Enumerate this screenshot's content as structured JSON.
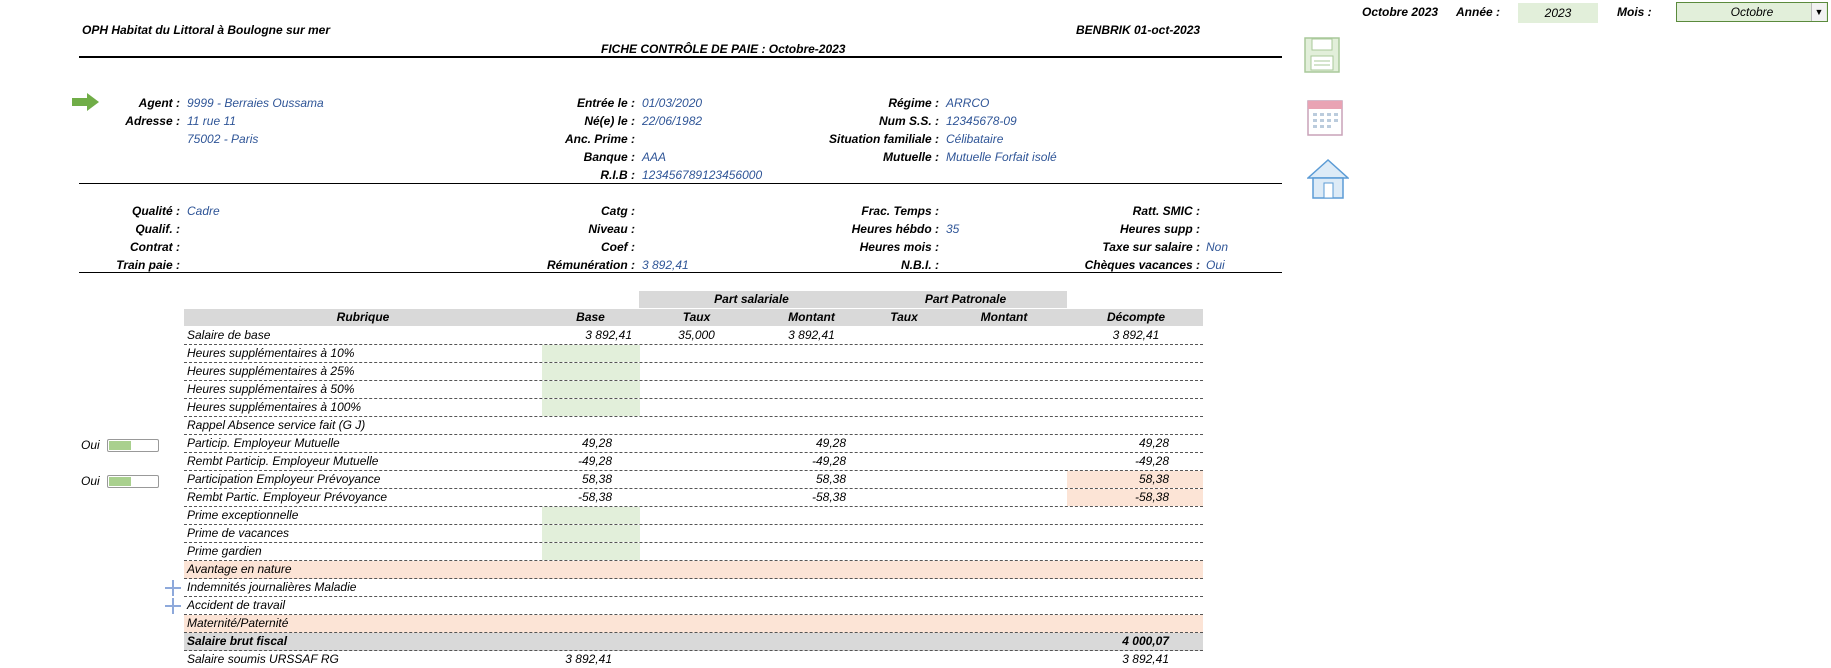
{
  "topbar": {
    "period": "Octobre 2023",
    "year_label": "Année :",
    "year_value": "2023",
    "month_label": "Mois :",
    "month_value": "Octobre"
  },
  "header": {
    "company": "OPH Habitat du Littoral à Boulogne sur mer",
    "stamp": "BENBRIK 01-oct-2023",
    "title": "FICHE CONTRÔLE DE PAIE : Octobre-2023"
  },
  "agent": {
    "agent_label": "Agent :",
    "agent_value": "9999 - Berraies Oussama",
    "adresse_label": "Adresse :",
    "adresse_line1": "11 rue 11",
    "adresse_line2": "75002 - Paris",
    "entree_label": "Entrée le :",
    "entree_value": "01/03/2020",
    "nele_label": "Né(e) le :",
    "nele_value": "22/06/1982",
    "ancprime_label": "Anc. Prime :",
    "banque_label": "Banque :",
    "banque_value": "AAA",
    "rib_label": "R.I.B :",
    "rib_value": "123456789123456000",
    "regime_label": "Régime :",
    "regime_value": "ARRCO",
    "numss_label": "Num S.S. :",
    "numss_value": "12345678-09",
    "sitfam_label": "Situation familiale :",
    "sitfam_value": "Célibataire",
    "mutuelle_label": "Mutuelle :",
    "mutuelle_value": "Mutuelle Forfait isolé"
  },
  "contract": {
    "qualite_label": "Qualité :",
    "qualite_value": "Cadre",
    "qualif_label": "Qualif. :",
    "contrat_label": "Contrat :",
    "trainpaie_label": "Train paie :",
    "catg_label": "Catg :",
    "niveau_label": "Niveau :",
    "coef_label": "Coef :",
    "remun_label": "Rémunération :",
    "remun_value": "3 892,41",
    "fractemps_label": "Frac. Temps :",
    "hhebdo_label": "Heures hébdo :",
    "hhebdo_value": "35",
    "hmois_label": "Heures mois :",
    "nbi_label": "N.B.I. :",
    "rattsmic_label": "Ratt. SMIC :",
    "hsupp_label": "Heures supp :",
    "taxe_label": "Taxe sur salaire :",
    "taxe_value": "Non",
    "cheques_label": "Chèques vacances :",
    "cheques_value": "Oui"
  },
  "table": {
    "group_salariale": "Part salariale",
    "group_patronale": "Part Patronale",
    "col_rubrique": "Rubrique",
    "col_base": "Base",
    "col_taux1": "Taux",
    "col_montant1": "Montant",
    "col_taux2": "Taux",
    "col_montant2": "Montant",
    "col_decompte": "Décompte",
    "rows": [
      {
        "label": "Salaire de base",
        "base": "3 892,41",
        "taux": "35,000",
        "montant": "3 892,41",
        "decompte": "3 892,41"
      },
      {
        "label": "Heures supplémentaires à 10%"
      },
      {
        "label": "Heures supplémentaires à 25%"
      },
      {
        "label": "Heures supplémentaires à 50%"
      },
      {
        "label": "Heures supplémentaires à 100%"
      },
      {
        "label": "Rappel Absence service fait (G J)"
      },
      {
        "label": "Particip. Employeur Mutuelle",
        "base": "49,28",
        "montant": "49,28",
        "decompte": "49,28",
        "side": "Oui"
      },
      {
        "label": "Rembt Particip. Employeur Mutuelle",
        "base": "-49,28",
        "montant": "-49,28",
        "decompte": "-49,28"
      },
      {
        "label": "Participation Employeur Prévoyance",
        "base": "58,38",
        "montant": "58,38",
        "decompte": "58,38",
        "side": "Oui"
      },
      {
        "label": "Rembt Partic. Employeur Prévoyance",
        "base": "-58,38",
        "montant": "-58,38",
        "decompte": "-58,38"
      },
      {
        "label": "Prime exceptionnelle"
      },
      {
        "label": "Prime de vacances"
      },
      {
        "label": "Prime gardien"
      },
      {
        "label": "Avantage en nature"
      },
      {
        "label": "Indemnités journalières Maladie"
      },
      {
        "label": "Accident de travail"
      },
      {
        "label": "Maternité/Paternité"
      },
      {
        "label": "Salaire brut fiscal",
        "decompte": "4 000,07"
      },
      {
        "label": "Salaire soumis URSSAF RG",
        "base": "3 892,41",
        "decompte": "3 892,41"
      }
    ]
  },
  "colors": {
    "accent_blue": "#2f5597",
    "green_fill": "#e2efda",
    "peach_fill": "#fce4d6",
    "header_grey": "#d9d9d9",
    "arrow_green": "#70ad47"
  },
  "icons": [
    "save-icon",
    "calendar-icon",
    "home-icon",
    "arrow-right-icon",
    "plus-icon"
  ]
}
